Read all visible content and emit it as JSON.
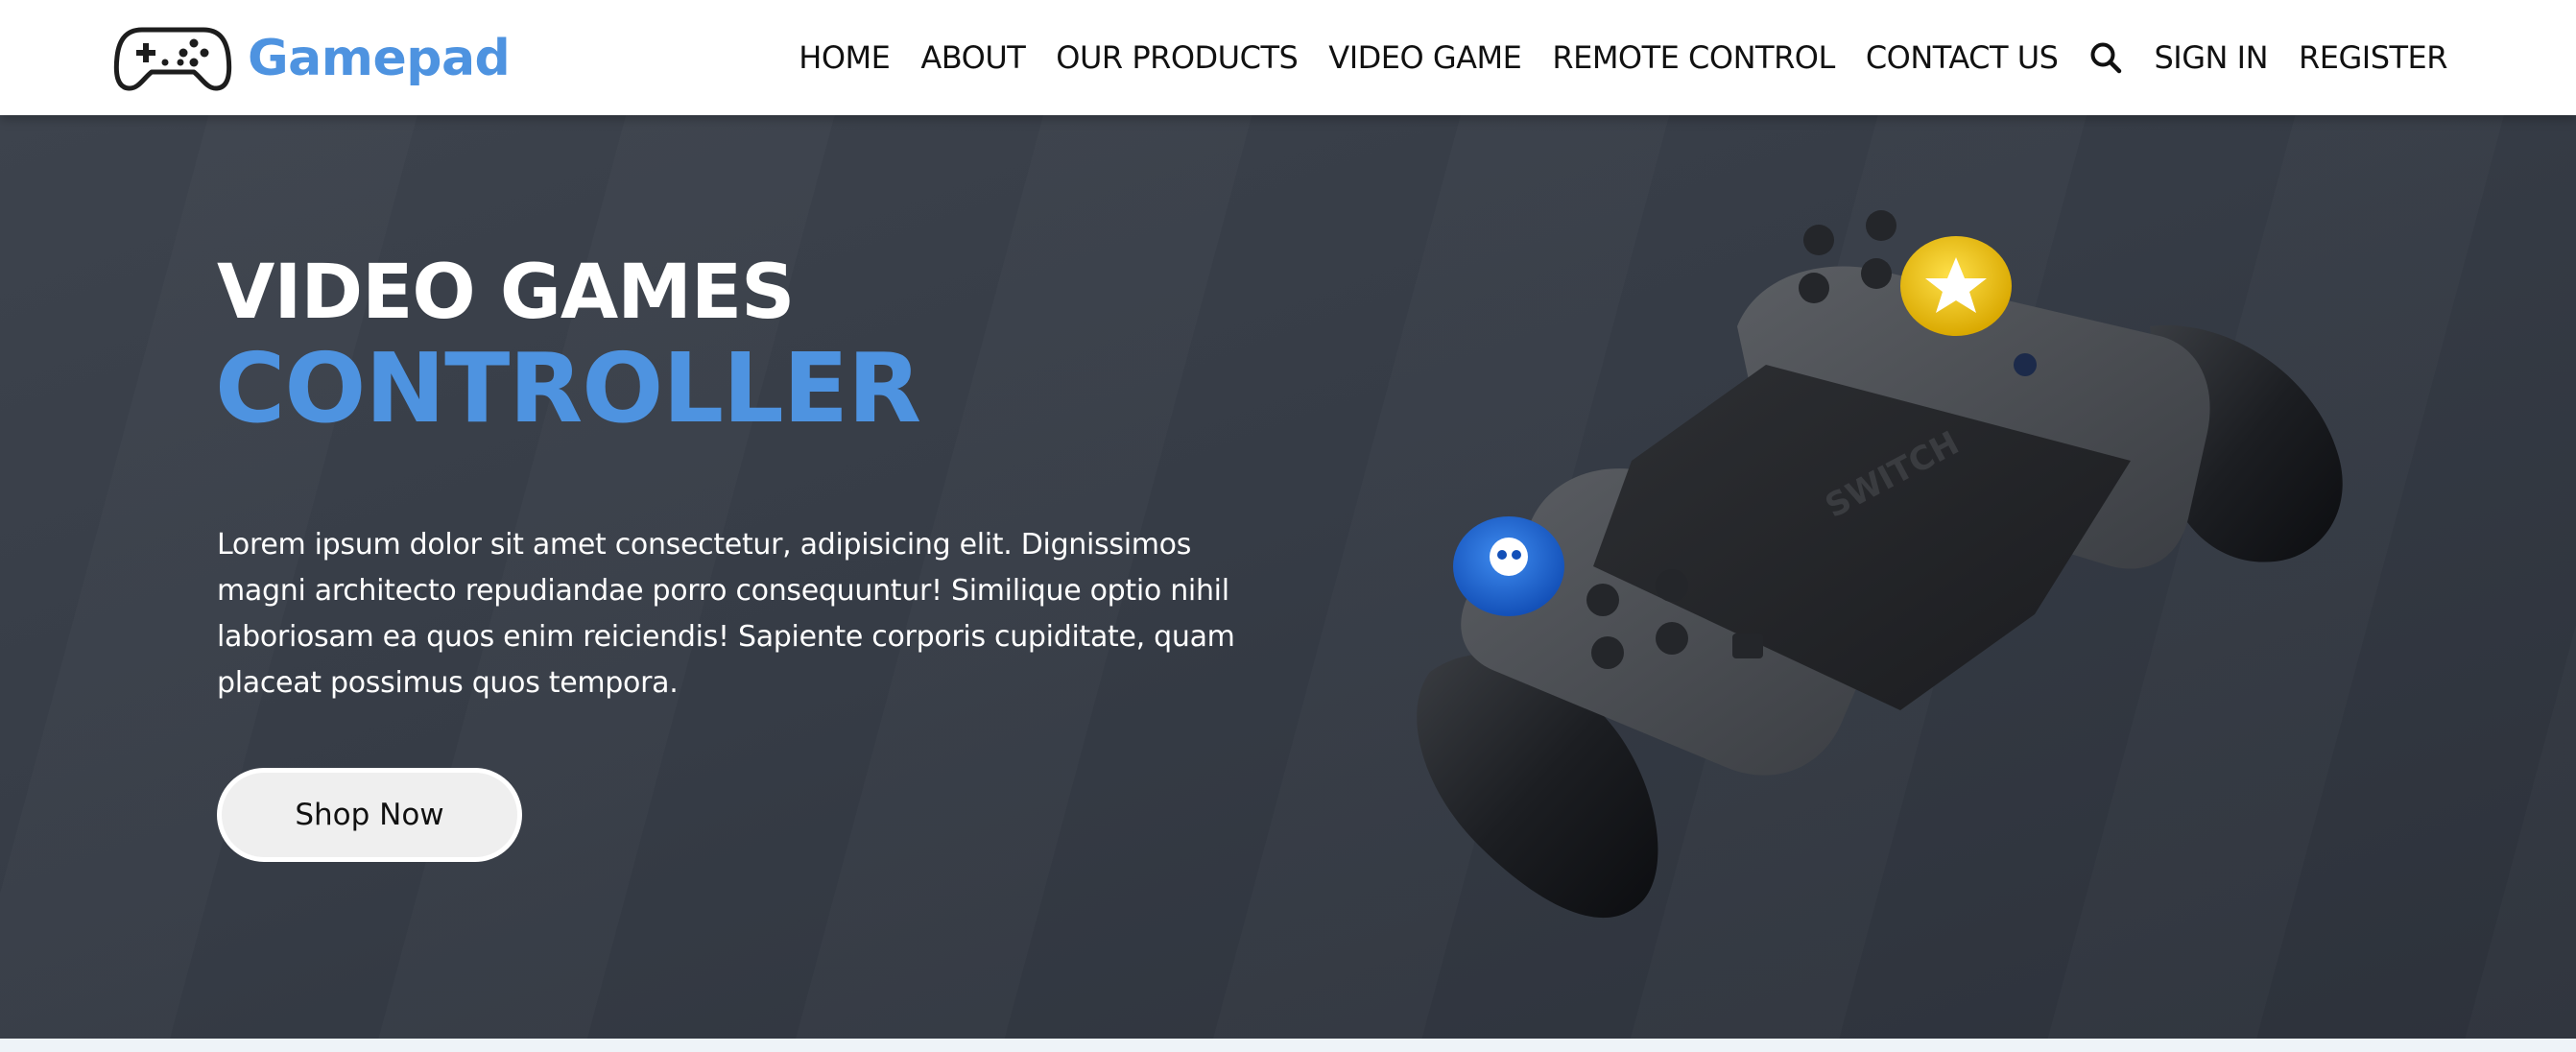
{
  "brand": {
    "name": "Gamepad",
    "logo_icon": "gamepad-icon",
    "color": "#4e93e0"
  },
  "nav": {
    "items": [
      {
        "label": "HOME"
      },
      {
        "label": "ABOUT"
      },
      {
        "label": "OUR PRODUCTS"
      },
      {
        "label": "VIDEO GAME"
      },
      {
        "label": "REMOTE CONTROL"
      },
      {
        "label": "CONTACT US"
      }
    ],
    "search_icon": "search-icon",
    "sign_in": "SIGN IN",
    "register": "REGISTER"
  },
  "hero": {
    "title_line1": "VIDEO GAMES",
    "title_line2": "CONTROLLER",
    "description": "Lorem ipsum dolor sit amet consectetur, adipisicing elit. Dignissimos magni architecto repudiandae porro consequuntur! Similique optio nihil laboriosam ea quos enim reiciendis! Sapiente corporis cupiditate, quam placeat possimus quos tempora.",
    "cta_label": "Shop Now",
    "image": "switch-joycon-grip-controller",
    "image_text": "SWITCH",
    "background_color": "#363c46",
    "accent_color": "#4e93e0"
  }
}
